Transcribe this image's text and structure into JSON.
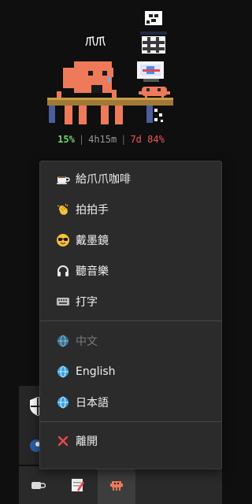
{
  "pet": {
    "name": "爪爪",
    "stats": {
      "percent_left": "15%",
      "duration": "4h15m",
      "days": "7d",
      "percent_right": "84%"
    },
    "colors": {
      "left_stat": "#6fd46a",
      "right_stat": "#f0555a",
      "body": "#ee7a5a"
    }
  },
  "menu": {
    "items": [
      {
        "label": "給爪爪咖啡",
        "icon": "coffee-icon"
      },
      {
        "label": "拍拍手",
        "icon": "clapping-hands-icon"
      },
      {
        "label": "戴墨鏡",
        "icon": "sunglasses-face-icon"
      },
      {
        "label": "聽音樂",
        "icon": "headphones-icon"
      },
      {
        "label": "打字",
        "icon": "keyboard-icon"
      }
    ],
    "languages": [
      {
        "label": "中文",
        "icon": "globe-icon",
        "disabled": true
      },
      {
        "label": "English",
        "icon": "globe-icon",
        "disabled": false
      },
      {
        "label": "日本語",
        "icon": "globe-icon",
        "disabled": false
      }
    ],
    "exit": {
      "label": "離開",
      "icon": "close-x-icon",
      "color": "#e8474a"
    }
  },
  "taskbar": {
    "tray_icons": [
      "shield-icon",
      "steam-icon"
    ],
    "buttons": [
      "coffee-cup-icon",
      "notepad-icon",
      "pet-icon"
    ]
  }
}
